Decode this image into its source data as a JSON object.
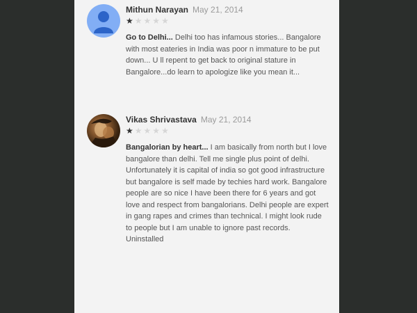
{
  "reviews": [
    {
      "author": "Mithun Narayan",
      "date": "May 21, 2014",
      "rating": 1,
      "max_rating": 5,
      "avatar": "default-avatar-icon",
      "title": "Go to Delhi...",
      "body": "Delhi too has infamous stories... Bangalore with most eateries in India was poor n immature to be put down... U ll repent to get back to original stature in Bangalore...do learn to apologize like you mean it..."
    },
    {
      "author": "Vikas Shrivastava",
      "date": "May 21, 2014",
      "rating": 1,
      "max_rating": 5,
      "avatar": "profile-photo",
      "title": "Bangalorian by heart...",
      "body": "I am basically from north but I love bangalore than delhi. Tell me single plus point of delhi. Unfortunately it is capital of india so got good infrastructure but bangalore is self made by techies hard work. Bangalore people are so nice I have been there for 6 years and got love and respect from bangalorians. Delhi people are expert in gang rapes and crimes than technical. I might look rude to people but I am unable to ignore past records. Uninstalled"
    }
  ],
  "colors": {
    "background": "#2b2e2c",
    "panel": "#f3f3f3",
    "avatar_default": "#82aef5",
    "star_filled": "#333333",
    "star_empty": "#d6d6d6"
  }
}
